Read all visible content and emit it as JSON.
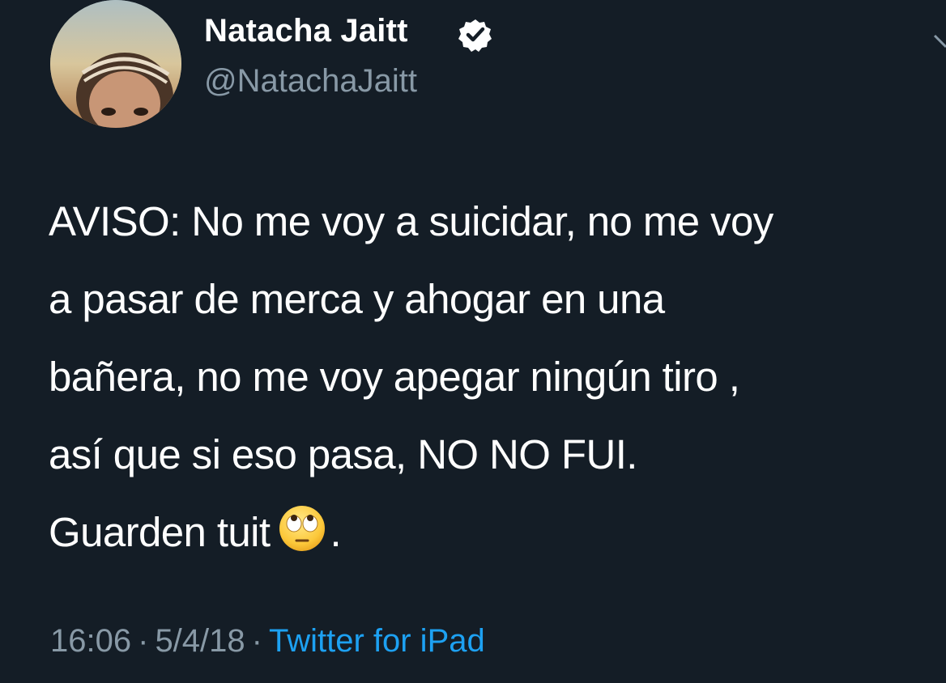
{
  "author": {
    "display_name": "Natacha Jaitt",
    "handle": "@NatachaJaitt",
    "verified": true,
    "avatar_icon": "profile-photo"
  },
  "tweet": {
    "lines": [
      "AVISO: No me voy a suicidar, no me voy",
      "a pasar de merca y ahogar en una",
      "bañera, no me voy apegar ningún tiro ,",
      "así que si eso pasa, NO NO FUI.",
      "Guarden tuit"
    ],
    "emoji_icon": "face-with-rolling-eyes-emoji",
    "trailing": "."
  },
  "meta": {
    "time": "16:06",
    "date": "5/4/18",
    "separator": "·",
    "source": "Twitter for iPad"
  },
  "colors": {
    "background": "#141d26",
    "text": "#ffffff",
    "secondary": "#8899a6",
    "link": "#1da1f2"
  }
}
